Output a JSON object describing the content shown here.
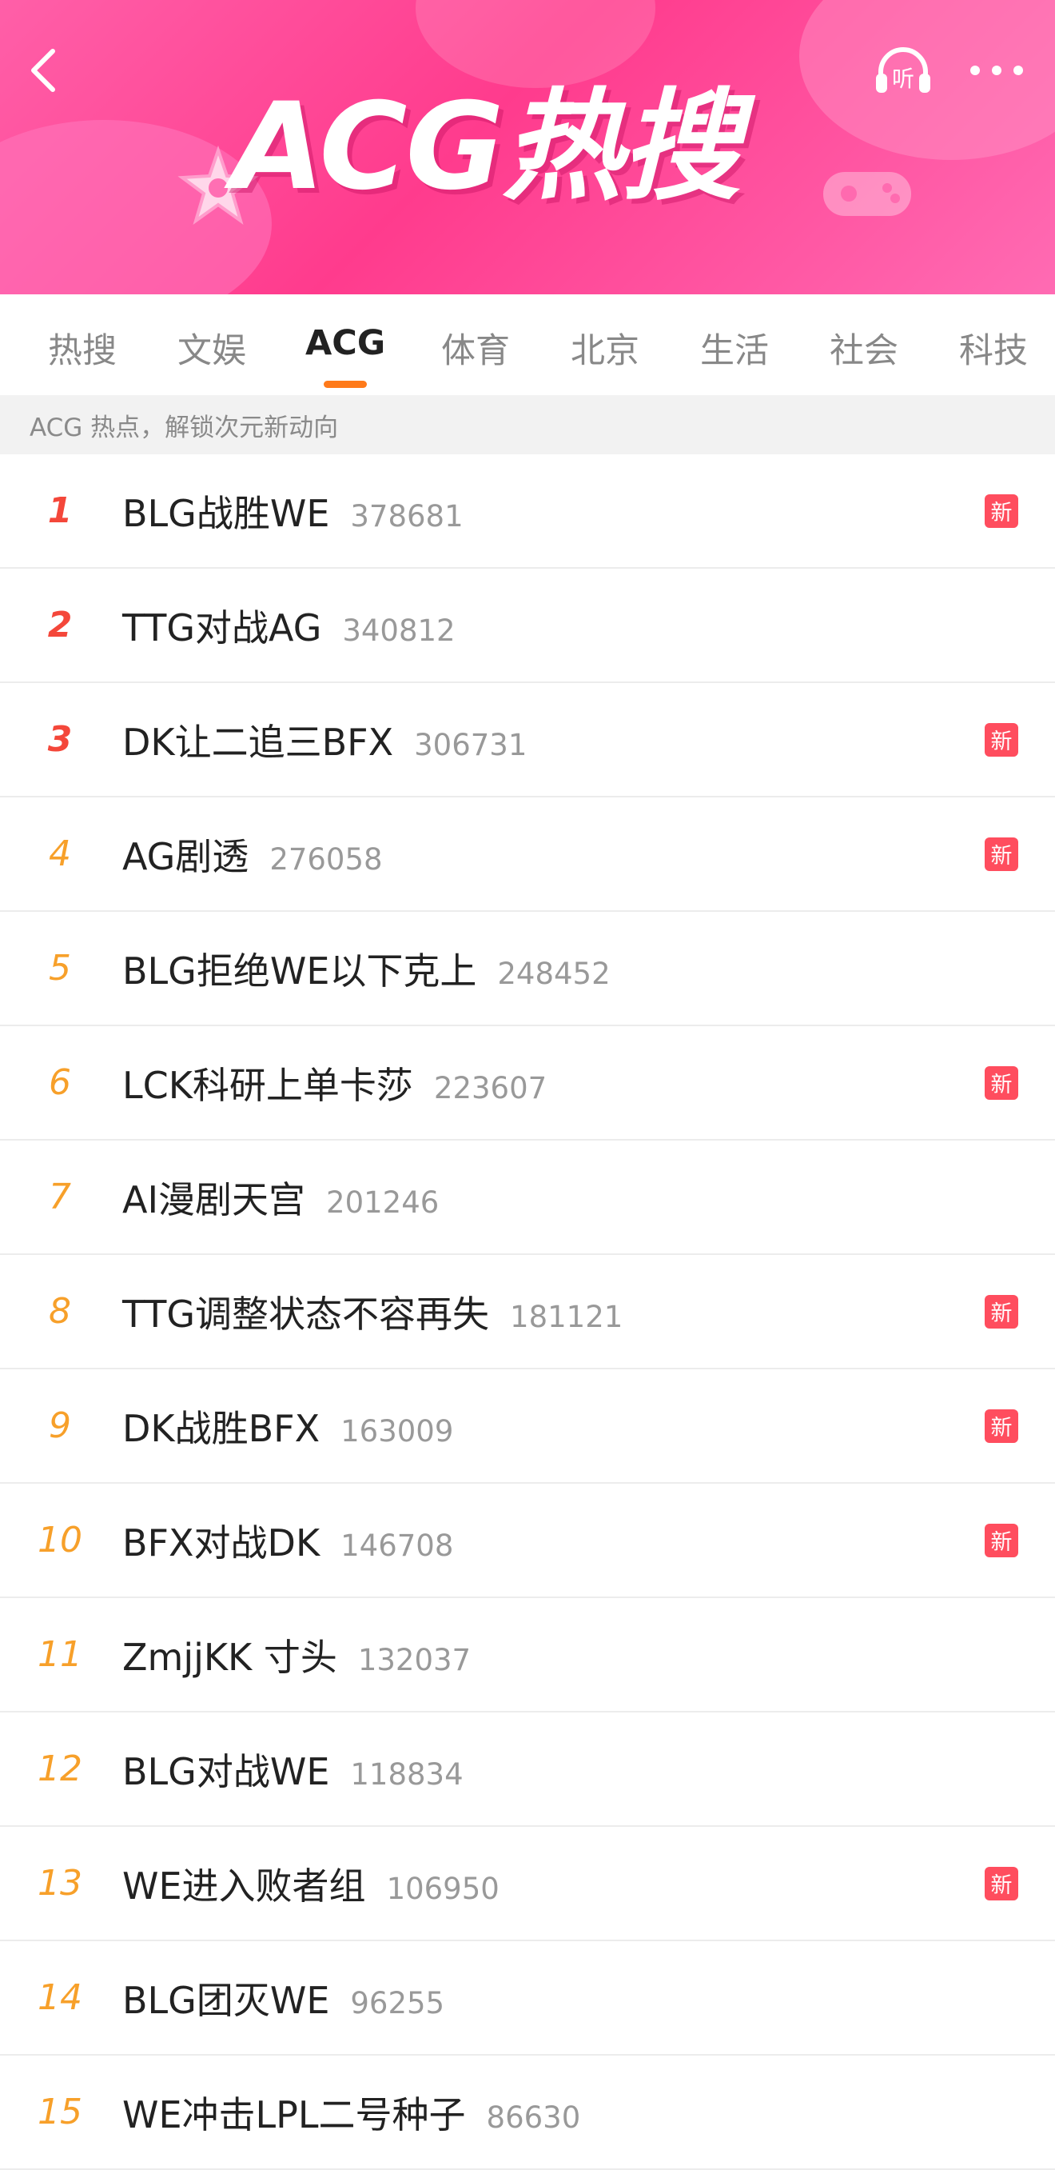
{
  "banner": {
    "title": "ACG热搜",
    "listen_label": "听",
    "icons": [
      "back-icon",
      "listen-icon",
      "more-icon"
    ],
    "colors": {
      "banner_pink": "#ff3b8d",
      "accent_orange": "#ff7a1a",
      "badge_red": "#ff4d5e",
      "rank_top": "#f4473a",
      "rank_other": "#f7a02a"
    }
  },
  "tabs": [
    {
      "label": "热搜",
      "active": false
    },
    {
      "label": "文娱",
      "active": false
    },
    {
      "label": "ACG",
      "active": true
    },
    {
      "label": "体育",
      "active": false
    },
    {
      "label": "北京",
      "active": false
    },
    {
      "label": "生活",
      "active": false
    },
    {
      "label": "社会",
      "active": false
    },
    {
      "label": "科技",
      "active": false
    }
  ],
  "subtitle": "ACG 热点，解锁次元新动向",
  "new_badge_label": "新",
  "items": [
    {
      "rank": "1",
      "title": "BLG战胜WE",
      "count": "378681",
      "is_new": true
    },
    {
      "rank": "2",
      "title": "TTG对战AG",
      "count": "340812",
      "is_new": false
    },
    {
      "rank": "3",
      "title": "DK让二追三BFX",
      "count": "306731",
      "is_new": true
    },
    {
      "rank": "4",
      "title": "AG剧透",
      "count": "276058",
      "is_new": true
    },
    {
      "rank": "5",
      "title": "BLG拒绝WE以下克上",
      "count": "248452",
      "is_new": false
    },
    {
      "rank": "6",
      "title": "LCK科研上单卡莎",
      "count": "223607",
      "is_new": true
    },
    {
      "rank": "7",
      "title": "AI漫剧天宫",
      "count": "201246",
      "is_new": false
    },
    {
      "rank": "8",
      "title": "TTG调整状态不容再失",
      "count": "181121",
      "is_new": true
    },
    {
      "rank": "9",
      "title": "DK战胜BFX",
      "count": "163009",
      "is_new": true
    },
    {
      "rank": "10",
      "title": "BFX对战DK",
      "count": "146708",
      "is_new": true
    },
    {
      "rank": "11",
      "title": "ZmjjKK 寸头",
      "count": "132037",
      "is_new": false
    },
    {
      "rank": "12",
      "title": "BLG对战WE",
      "count": "118834",
      "is_new": false
    },
    {
      "rank": "13",
      "title": "WE进入败者组",
      "count": "106950",
      "is_new": true
    },
    {
      "rank": "14",
      "title": "BLG团灭WE",
      "count": "96255",
      "is_new": false
    },
    {
      "rank": "15",
      "title": "WE冲击LPL二号种子",
      "count": "86630",
      "is_new": false
    }
  ]
}
